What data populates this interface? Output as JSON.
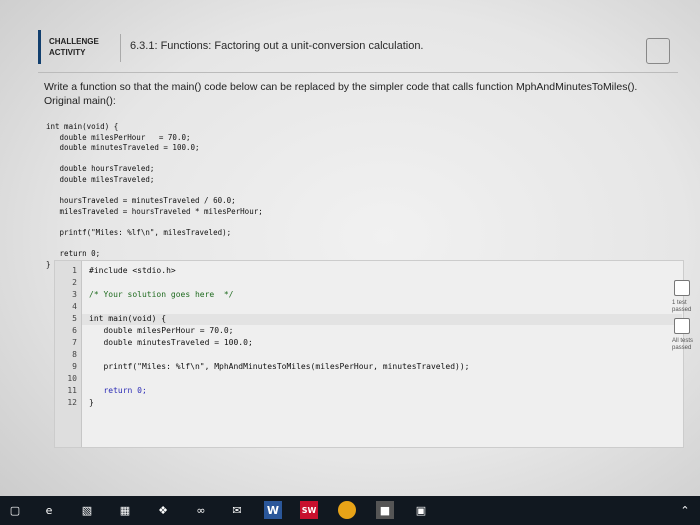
{
  "header": {
    "badge_line1": "CHALLENGE",
    "badge_line2": "ACTIVITY",
    "title": "6.3.1: Functions: Factoring out a unit-conversion calculation."
  },
  "description": {
    "line1": "Write a function so that the main() code below can be replaced by the simpler code that calls function MphAndMinutesToMiles().",
    "line2": "Original main():"
  },
  "original_code": [
    "int main(void) {",
    "   double milesPerHour   = 70.0;",
    "   double minutesTraveled = 100.0;",
    "",
    "   double hoursTraveled;",
    "   double milesTraveled;",
    "",
    "   hoursTraveled = minutesTraveled / 60.0;",
    "   milesTraveled = hoursTraveled * milesPerHour;",
    "",
    "   printf(\"Miles: %lf\\n\", milesTraveled);",
    "",
    "   return 0;",
    "}"
  ],
  "editor": {
    "line_numbers": [
      "1",
      "2",
      "3",
      "4",
      "5",
      "6",
      "7",
      "8",
      "9",
      "10",
      "11",
      "12"
    ],
    "lines": [
      "#include <stdio.h>",
      "",
      "/* Your solution goes here  */",
      "",
      "int main(void) {",
      "   double milesPerHour = 70.0;",
      "   double minutesTraveled = 100.0;",
      "",
      "   printf(\"Miles: %lf\\n\", MphAndMinutesToMiles(milesPerHour, minutesTraveled));",
      "",
      "   return 0;",
      "}"
    ]
  },
  "side": {
    "label1": "1 test passed",
    "label2": "All tests passed"
  },
  "taskbar": {
    "items": [
      "start-icon",
      "edge-icon",
      "file-explorer-icon",
      "store-icon",
      "dropbox-icon",
      "infinity-icon",
      "mail-icon",
      "word-icon",
      "solidworks-icon",
      "chrome-icon",
      "app-icon",
      "photos-icon"
    ],
    "word_label": "W",
    "sw_label": "SW"
  }
}
